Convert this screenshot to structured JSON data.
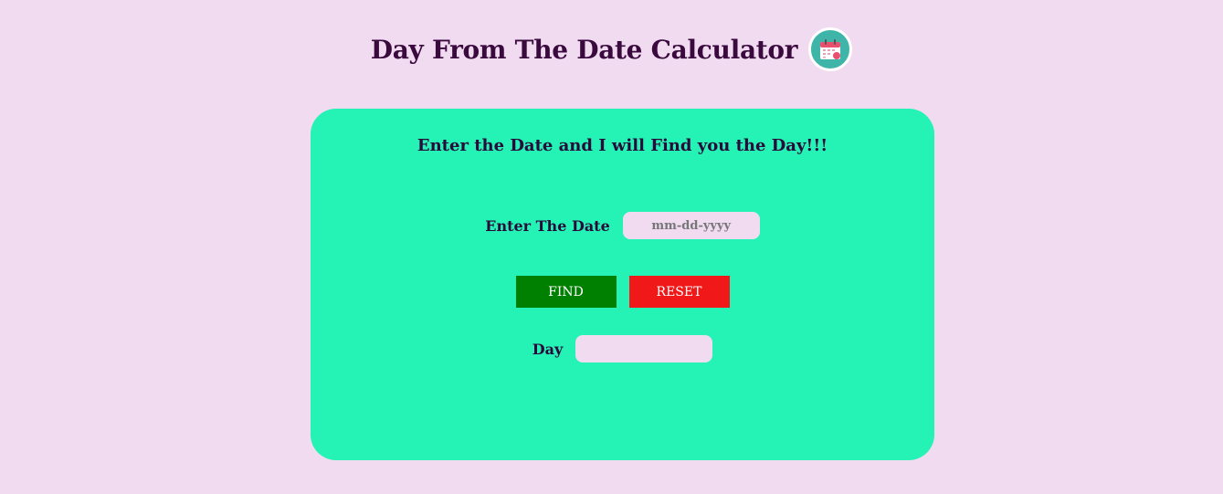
{
  "header": {
    "title": "Day From The Date Calculator",
    "logo_icon": "calendar-icon"
  },
  "card": {
    "subtitle": "Enter the Date and I will Find you the Day!!!",
    "date_label": "Enter The Date",
    "date_input": {
      "value": "",
      "placeholder": "mm-dd-yyyy"
    },
    "find_button": "FIND",
    "reset_button": "RESET",
    "day_label": "Day",
    "day_output": {
      "value": ""
    }
  },
  "colors": {
    "background": "#f0dbf0",
    "card": "#25f2b5",
    "find": "#008000",
    "reset": "#f01818",
    "text": "#2a0a3a"
  }
}
